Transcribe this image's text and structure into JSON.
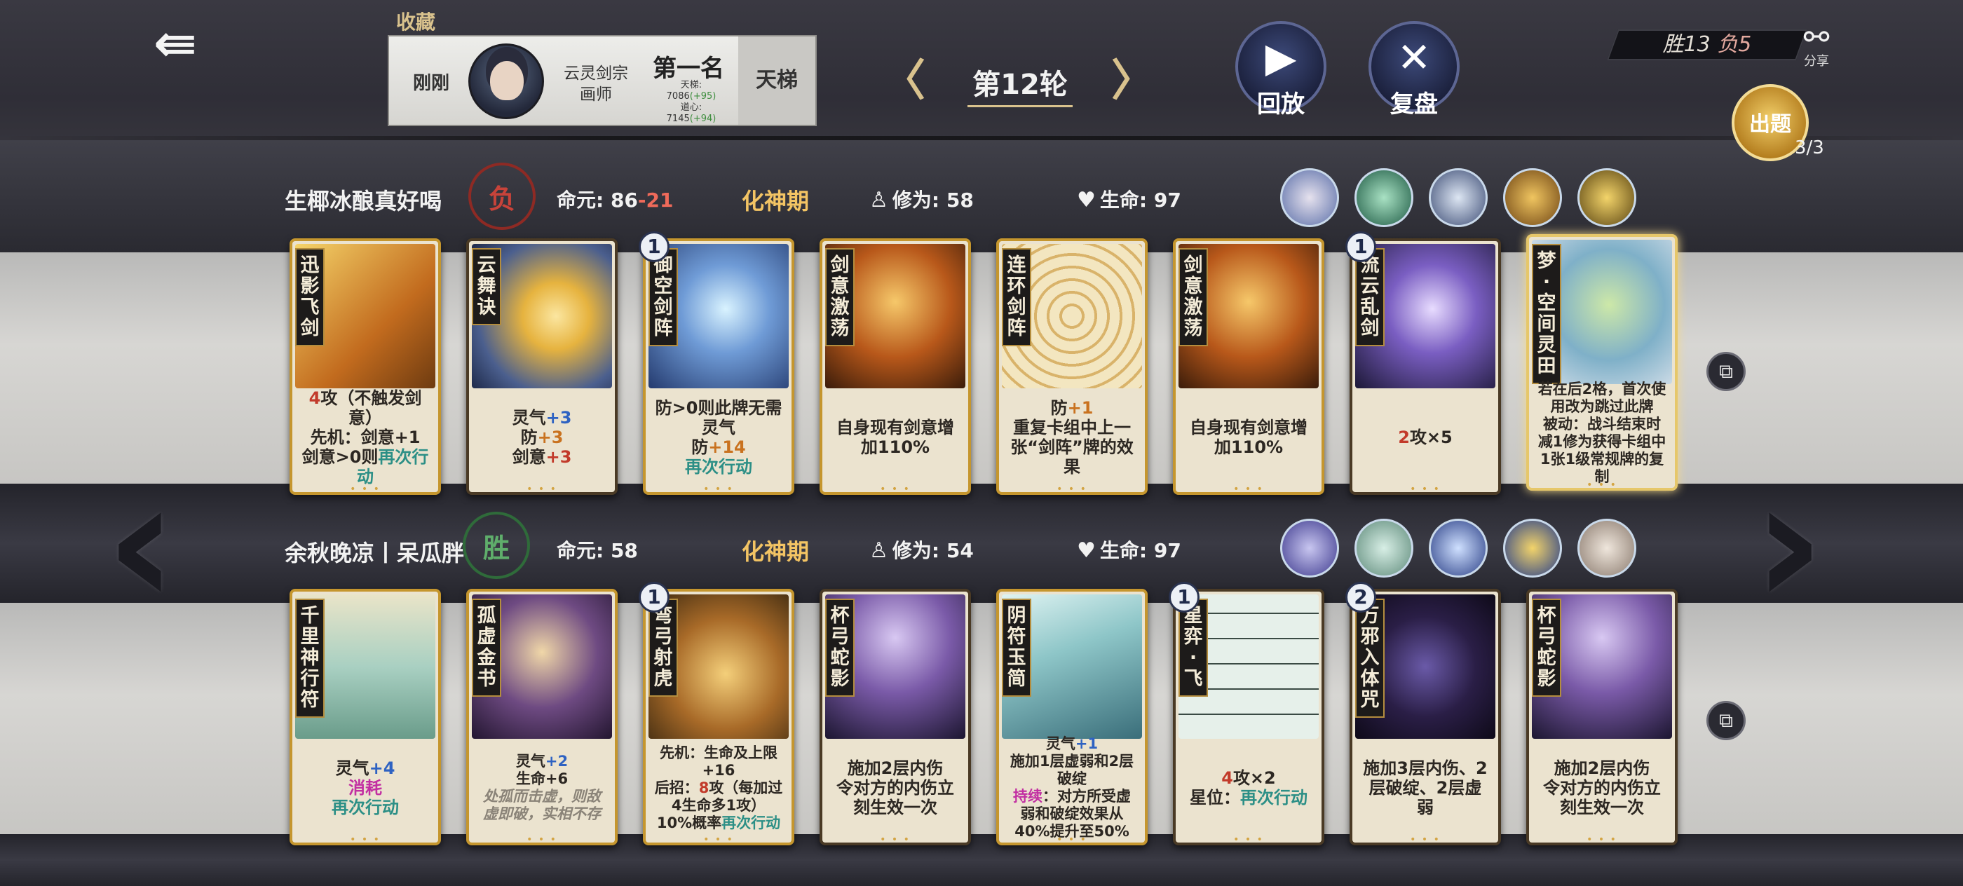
{
  "header": {
    "favorites_label": "收藏",
    "opponent": {
      "time": "刚刚",
      "sect": "云灵剑宗",
      "title": "画师",
      "rank": "第一名",
      "ladder_score_label": "天梯:",
      "ladder_score": "7086",
      "ladder_score_delta": "(+95)",
      "mind_label": "道心:",
      "mind_score": "7145",
      "mind_delta": "(+94)",
      "mode": "天梯"
    },
    "round_label": "第12轮",
    "replay_label": "回放",
    "review_label": "复盘",
    "score_win": "胜13",
    "score_lose": "负5",
    "share_label": "分享",
    "problem_label": "出题",
    "problem_count": "3/3"
  },
  "players": [
    {
      "name": "生椰冰酿真好喝",
      "result": "负",
      "destiny_label": "命元:",
      "destiny_value": "86",
      "destiny_loss": "-21",
      "realm": "化神期",
      "cultivation_label": "修为:",
      "cultivation": "58",
      "hp_label": "生命:",
      "hp": "97",
      "cards": [
        {
          "name": "迅影飞剑",
          "level": "",
          "desc": [
            [
              "red",
              "4"
            ],
            [
              "",
              "攻（不触发剑意）"
            ],
            [
              "br",
              ""
            ],
            [
              "",
              "先机：剑意+1"
            ],
            [
              "br",
              ""
            ],
            [
              "",
              "剑意>0则"
            ],
            [
              "teal",
              "再次行动"
            ]
          ]
        },
        {
          "name": "云舞诀",
          "level": "",
          "desc": [
            [
              "",
              "灵气"
            ],
            [
              "blue",
              "+3"
            ],
            [
              "br",
              ""
            ],
            [
              "",
              "防"
            ],
            [
              "orange",
              "+3"
            ],
            [
              "br",
              ""
            ],
            [
              "",
              "剑意"
            ],
            [
              "red",
              "+3"
            ]
          ]
        },
        {
          "name": "御空剑阵",
          "level": "1",
          "desc": [
            [
              "",
              "防>0则此牌无需灵气"
            ],
            [
              "br",
              ""
            ],
            [
              "",
              "防"
            ],
            [
              "orange",
              "+14"
            ],
            [
              "br",
              ""
            ],
            [
              "teal",
              "再次行动"
            ]
          ]
        },
        {
          "name": "剑意激荡",
          "level": "",
          "desc": [
            [
              "",
              "自身现有剑意增加110%"
            ]
          ]
        },
        {
          "name": "连环剑阵",
          "level": "",
          "desc": [
            [
              "",
              "防"
            ],
            [
              "orange",
              "+1"
            ],
            [
              "br",
              ""
            ],
            [
              "",
              "重复卡组中上一张“剑阵”牌的效果"
            ]
          ]
        },
        {
          "name": "剑意激荡",
          "level": "",
          "desc": [
            [
              "",
              "自身现有剑意增加110%"
            ]
          ]
        },
        {
          "name": "流云乱剑",
          "level": "1",
          "desc": [
            [
              "red",
              "2"
            ],
            [
              "",
              "攻×5"
            ]
          ]
        },
        {
          "name": "梦·空间灵田",
          "level": "",
          "desc": [
            [
              "",
              "若在后2格，首次使用改为跳过此牌"
            ],
            [
              "br",
              ""
            ],
            [
              "",
              "被动：战斗结束时减1修为获得卡组中1张1级常规牌的复制"
            ]
          ]
        }
      ],
      "relics": [
        "relic-portrait-girl",
        "relic-jade-sword",
        "relic-portrait-maiden",
        "relic-golden-blade",
        "relic-golden-cross"
      ]
    },
    {
      "name": "余秋晚凉丨呆瓜胖",
      "result": "胜",
      "destiny_label": "命元:",
      "destiny_value": "58",
      "realm": "化神期",
      "cultivation_label": "修为:",
      "cultivation": "54",
      "hp_label": "生命:",
      "hp": "97",
      "cards": [
        {
          "name": "千里神行符",
          "level": "",
          "desc": [
            [
              "",
              "灵气"
            ],
            [
              "blue",
              "+4"
            ],
            [
              "br",
              ""
            ],
            [
              "pink",
              "消耗"
            ],
            [
              "br",
              ""
            ],
            [
              "teal",
              "再次行动"
            ]
          ]
        },
        {
          "name": "孤虚金书",
          "level": "",
          "desc": [
            [
              "",
              "灵气"
            ],
            [
              "blue",
              "+2"
            ],
            [
              "br",
              ""
            ],
            [
              "",
              "生命+6"
            ],
            [
              "br",
              ""
            ],
            [
              "grey",
              "处孤而击虚，则敌虚即破，实相不存"
            ]
          ]
        },
        {
          "name": "弯弓射虎",
          "level": "1",
          "desc": [
            [
              "",
              "先机：生命及上限+16"
            ],
            [
              "br",
              ""
            ],
            [
              "",
              "后招："
            ],
            [
              "red",
              "8"
            ],
            [
              "",
              "攻（每加过4生命多1攻）"
            ],
            [
              "br",
              ""
            ],
            [
              "",
              "10%概率"
            ],
            [
              "teal",
              "再次行动"
            ]
          ]
        },
        {
          "name": "杯弓蛇影",
          "level": "",
          "desc": [
            [
              "",
              "施加2层内伤"
            ],
            [
              "br",
              ""
            ],
            [
              "",
              "令对方的内伤立刻生效一次"
            ]
          ]
        },
        {
          "name": "阴符玉简",
          "level": "",
          "desc": [
            [
              "",
              "灵气"
            ],
            [
              "blue",
              "+1"
            ],
            [
              "br",
              ""
            ],
            [
              "",
              "施加1层虚弱和2层破绽"
            ],
            [
              "br",
              ""
            ],
            [
              "pink",
              "持续"
            ],
            [
              "",
              "：对方所受虚弱和破绽效果从40%提升至50%"
            ]
          ]
        },
        {
          "name": "星弈·飞",
          "level": "1",
          "desc": [
            [
              "red",
              "4"
            ],
            [
              "",
              "攻×2"
            ],
            [
              "br",
              ""
            ],
            [
              "",
              "星位："
            ],
            [
              "teal",
              "再次行动"
            ]
          ]
        },
        {
          "name": "万邪入体咒",
          "level": "2",
          "desc": [
            [
              "",
              "施加3层内伤、2层破绽、2层虚弱"
            ]
          ]
        },
        {
          "name": "杯弓蛇影",
          "level": "",
          "desc": [
            [
              "",
              "施加2层内伤"
            ],
            [
              "br",
              ""
            ],
            [
              "",
              "令对方的内伤立刻生效一次"
            ]
          ]
        }
      ],
      "relics": [
        "relic-scroll",
        "relic-jade-slip",
        "relic-star-orb",
        "relic-taiji",
        "relic-portrait-lady"
      ]
    }
  ],
  "colors": {
    "realm": "#f3c464",
    "lose": "#c8433a",
    "win": "#5fae6b",
    "accent_gold": "#d9c28d"
  }
}
